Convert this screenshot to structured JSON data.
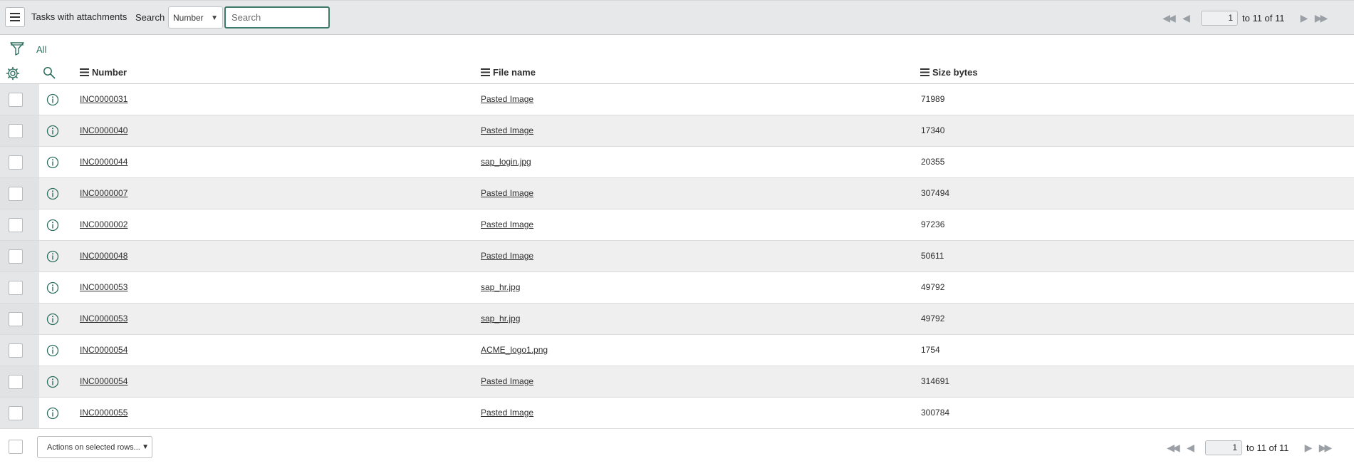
{
  "header": {
    "menu_icon": "hamburger-icon",
    "title": "Tasks with attachments",
    "search_label": "Search",
    "field_select": "Number",
    "search_placeholder": "Search",
    "pager": {
      "first": "◀◀",
      "prev": "◀",
      "page": "1",
      "range": "to 11 of 11",
      "next": "▶",
      "last": "▶▶"
    }
  },
  "filter": {
    "icon": "funnel-icon",
    "breadcrumb": "All"
  },
  "table": {
    "columns": [
      "Number",
      "File name",
      "Size bytes"
    ],
    "rows": [
      {
        "number": "INC0000031",
        "file_name": "Pasted Image",
        "size_bytes": "71989"
      },
      {
        "number": "INC0000040",
        "file_name": "Pasted Image",
        "size_bytes": "17340"
      },
      {
        "number": "INC0000044",
        "file_name": "sap_login.jpg",
        "size_bytes": "20355"
      },
      {
        "number": "INC0000007",
        "file_name": "Pasted Image",
        "size_bytes": "307494"
      },
      {
        "number": "INC0000002",
        "file_name": "Pasted Image",
        "size_bytes": "97236"
      },
      {
        "number": "INC0000048",
        "file_name": "Pasted Image",
        "size_bytes": "50611"
      },
      {
        "number": "INC0000053",
        "file_name": "sap_hr.jpg",
        "size_bytes": "49792"
      },
      {
        "number": "INC0000053",
        "file_name": "sap_hr.jpg",
        "size_bytes": "49792"
      },
      {
        "number": "INC0000054",
        "file_name": "ACME_logo1.png",
        "size_bytes": "1754"
      },
      {
        "number": "INC0000054",
        "file_name": "Pasted Image",
        "size_bytes": "314691"
      },
      {
        "number": "INC0000055",
        "file_name": "Pasted Image",
        "size_bytes": "300784"
      }
    ]
  },
  "footer": {
    "actions_label": "Actions on selected rows...",
    "pager": {
      "first": "◀◀",
      "prev": "◀",
      "page": "1",
      "range": "to 11 of 11",
      "next": "▶",
      "last": "▶▶"
    }
  },
  "colors": {
    "accent": "#2d6f5e",
    "header_bg": "#e6e8ea",
    "row_alt_bg": "#efefef"
  }
}
